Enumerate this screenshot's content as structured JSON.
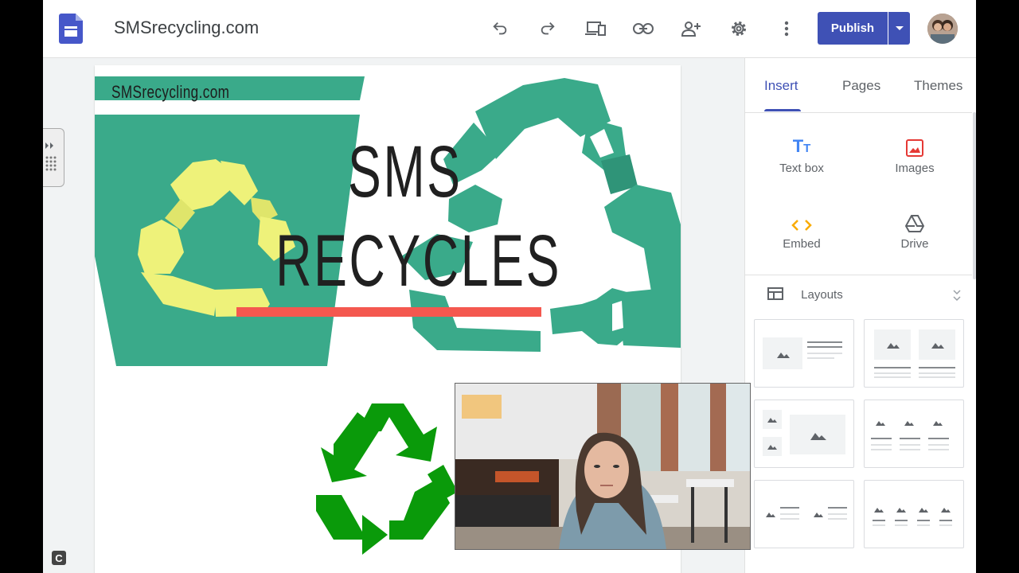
{
  "header": {
    "site_name": "SMSrecycling.com",
    "publish_label": "Publish",
    "icons": [
      "google-sites-logo-icon",
      "undo-icon",
      "redo-icon",
      "preview-devices-icon",
      "link-icon",
      "share-person-add-icon",
      "settings-gear-icon",
      "more-vert-icon",
      "dropdown-arrow-icon"
    ]
  },
  "page": {
    "banner_site_text": "SMSrecycling.com",
    "headline_line1": "SMS",
    "headline_line2": "RECYCLES"
  },
  "panel": {
    "tabs": [
      {
        "label": "Insert",
        "active": true
      },
      {
        "label": "Pages",
        "active": false
      },
      {
        "label": "Themes",
        "active": false
      }
    ],
    "insert_items": [
      {
        "label": "Text box",
        "icon": "text-box-icon"
      },
      {
        "label": "Images",
        "icon": "image-icon"
      },
      {
        "label": "Embed",
        "icon": "embed-code-icon"
      },
      {
        "label": "Drive",
        "icon": "drive-icon"
      }
    ],
    "layouts_label": "Layouts"
  },
  "bottom_badge": "C",
  "colors": {
    "accent": "#3f51b5",
    "teal": "#3aaa8a",
    "yellow": "#eef27a",
    "red_bar": "#f4584f",
    "recycle_green": "#0a9a0a"
  }
}
